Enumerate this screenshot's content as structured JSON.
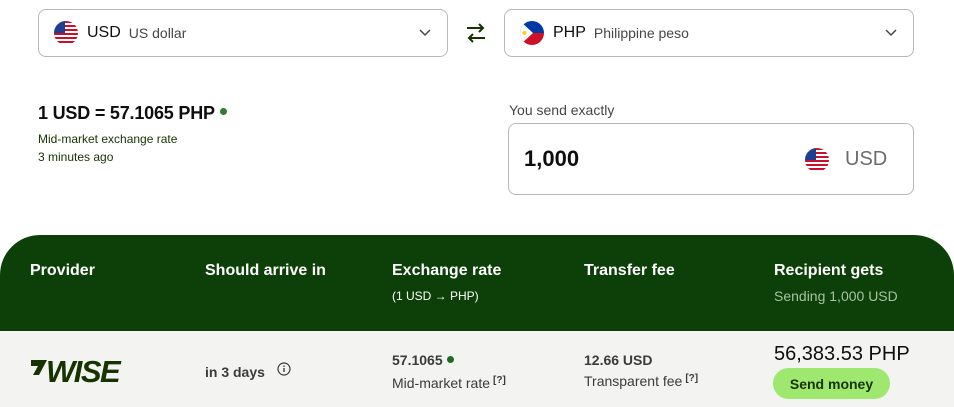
{
  "from_currency": {
    "code": "USD",
    "name": "US dollar",
    "flag_icon": "us-flag-icon"
  },
  "to_currency": {
    "code": "PHP",
    "name": "Philippine peso",
    "flag_icon": "ph-flag-icon"
  },
  "rate": {
    "summary": "1 USD = 57.1065 PHP",
    "label": "Mid-market exchange rate",
    "updated": "3 minutes ago"
  },
  "send": {
    "label": "You send exactly",
    "amount": "1,000",
    "currency": "USD"
  },
  "table": {
    "headers": {
      "provider": "Provider",
      "arrive": "Should arrive in",
      "rate": "Exchange rate",
      "rate_sub": "(1 USD → PHP)",
      "fee": "Transfer fee",
      "gets": "Recipient gets",
      "gets_sub": "Sending 1,000 USD"
    },
    "rows": [
      {
        "provider": "WISE",
        "arrive": "in 3 days",
        "rate": "57.1065",
        "rate_note": "Mid-market rate",
        "help": "[?]",
        "fee": "12.66 USD",
        "fee_note": "Transparent fee",
        "gets": "56,383.53 PHP",
        "action": "Send money"
      }
    ]
  },
  "colors": {
    "header_bg": "#0d4008",
    "row_bg": "#f3f3f1",
    "button_bg": "#9fe870",
    "brand_dark": "#163300"
  }
}
